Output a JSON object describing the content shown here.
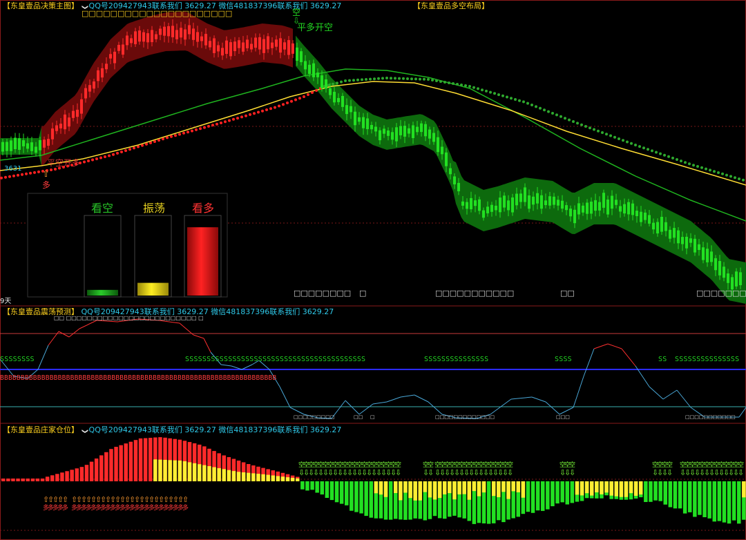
{
  "panel1": {
    "title": "【东皇壹品决策主图】",
    "chevron": "❯",
    "qq": "QQ号209427943联系我们 3629.27",
    "wechat": "微信481837396联系我们 3629.27",
    "subtitle": "□□□□□□□□□□□□□□□□□□□□□",
    "right_title": "【东皇壹品多空布局】",
    "signal_short_char": "空",
    "signal_short_text": "平多开空",
    "signal_long_text": "平空开多",
    "signal_long_char": "多",
    "price_label": "3631",
    "days_label": "9天",
    "gauge": {
      "labels": [
        "看空",
        "振荡",
        "看多"
      ],
      "levels": [
        0.08,
        0.18,
        0.97
      ]
    },
    "bottom_boxes": [
      "□□□□□□□□",
      "□",
      "□□□□□□□□□□□",
      "□□",
      "□□□□□□□□"
    ]
  },
  "panel2": {
    "title": "【东皇壹品震荡预测】",
    "qq": "QQ号209427943联系我们 3629.27",
    "wechat": "微信481837396联系我们 3629.27",
    "top_boxes": "□□ □□□□□□□□□□□□□□□□□□□□□□□□□          □",
    "s_runs": [
      "SSSSSSSS",
      "SSSSSSSSSSSSSSSSSSSSSSSSSSSSSSSSSSSSSSSSSS",
      "SSSSSSSSSSSSSSS",
      "SSSS",
      "SS",
      "SSSSSSSSSSSSSSS"
    ],
    "b_run": "BBBBBBBBBBBBBBBBBBBBBBBBBBBBBBBBBBBBBBBBBBBBBBBBBBBBBBBBBBBBBBBBBBB",
    "bottom_boxes": [
      "□□□□□□□□□",
      "□□",
      "□",
      "□□□□□□□□□□□□□",
      "□□□",
      "□□□□□□□□□□□"
    ]
  },
  "panel3": {
    "title": "【东皇壹品庄家仓位】",
    "qq": "QQ号209427943联系我们 3629.27",
    "wechat": "微信481837396联系我们 3629.27",
    "short_label": "空",
    "long_label": "多"
  },
  "colors": {
    "bull": "#ff2a2a",
    "bear": "#22e022",
    "yellow": "#ffee33",
    "band_red": "#6a0a0a",
    "band_green": "#0d6a0d",
    "ma_green": "#1fb41f",
    "ma_yellow": "#ffdd33",
    "blue_line": "#2b2bff",
    "osc_line": "#4aa8d8",
    "panel_border": "#8a1a1a"
  }
}
